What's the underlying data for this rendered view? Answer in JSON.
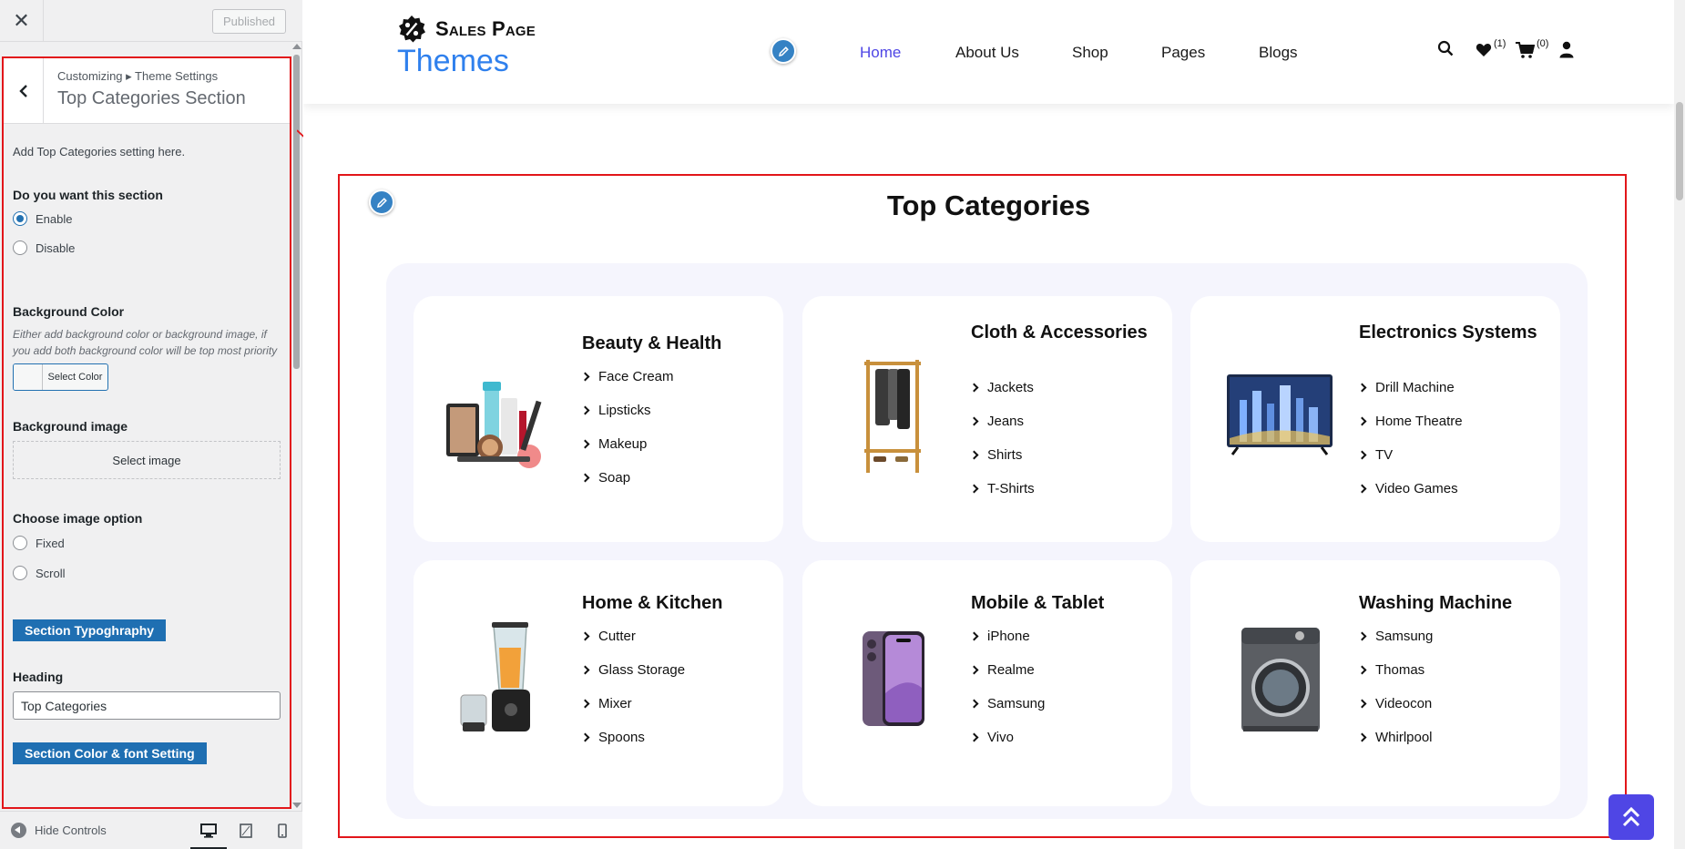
{
  "customizer": {
    "close_icon": "close-icon",
    "published_label": "Published",
    "breadcrumb": "Customizing ▸ Theme Settings",
    "section_title": "Top Categories Section",
    "description": "Add Top Categories setting here.",
    "enable_question": "Do you want this section",
    "enable_options": [
      "Enable",
      "Disable"
    ],
    "enable_selected": "Enable",
    "bg_color_label": "Background Color",
    "bg_color_note": "Either add background color or background image, if you add both background color will be top most priority",
    "select_color_label": "Select Color",
    "bg_image_label": "Background image",
    "select_image_label": "Select image",
    "image_option_label": "Choose image option",
    "image_options": [
      "Fixed",
      "Scroll"
    ],
    "section_typography_label": "Section Typoghraphy",
    "heading_label": "Heading",
    "heading_value": "Top Categories",
    "section_color_font_label": "Section Color & font Setting",
    "hide_controls_label": "Hide Controls",
    "accent_color": "#2271b1",
    "highlight_color": "#e2161a"
  },
  "site": {
    "logo_name": "Sales Page",
    "logo_themes": "Themes",
    "nav": [
      "Home",
      "About Us",
      "Shop",
      "Pages",
      "Blogs"
    ],
    "nav_active": "Home",
    "wishlist_count": "(1)",
    "cart_count": "(0)",
    "accent_color": "#4f46e5",
    "section_heading": "Top Categories",
    "categories": [
      {
        "title": "Beauty & Health",
        "icon": "cosmetics-image",
        "items": [
          "Face Cream",
          "Lipsticks",
          "Makeup",
          "Soap"
        ]
      },
      {
        "title": "Cloth & Accessories",
        "icon": "clothes-rack-image",
        "items": [
          "Jackets",
          "Jeans",
          "Shirts",
          "T-Shirts"
        ]
      },
      {
        "title": "Electronics Systems",
        "icon": "tv-image",
        "items": [
          "Drill Machine",
          "Home Theatre",
          "TV",
          "Video Games"
        ]
      },
      {
        "title": "Home & Kitchen",
        "icon": "blender-image",
        "items": [
          "Cutter",
          "Glass Storage",
          "Mixer",
          "Spoons"
        ]
      },
      {
        "title": "Mobile & Tablet",
        "icon": "smartphone-image",
        "items": [
          "iPhone",
          "Realme",
          "Samsung",
          "Vivo"
        ]
      },
      {
        "title": "Washing Machine",
        "icon": "washing-machine-image",
        "items": [
          "Samsung",
          "Thomas",
          "Videocon",
          "Whirlpool"
        ]
      }
    ]
  }
}
